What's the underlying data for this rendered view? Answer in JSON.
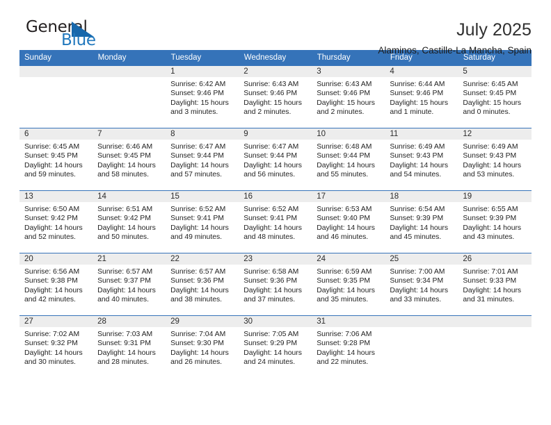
{
  "brand": {
    "name_part1": "General",
    "name_part2": "Blue",
    "logo_icon": "triangle-logo-icon",
    "colors": {
      "accent": "#2178bd",
      "dark": "#231f20"
    }
  },
  "header": {
    "title": "July 2025",
    "subtitle": "Alaminos, Castille-La Mancha, Spain"
  },
  "calendar": {
    "header_bg": "#3573b9",
    "daynum_bg": "#ededed",
    "weekdays": [
      "Sunday",
      "Monday",
      "Tuesday",
      "Wednesday",
      "Thursday",
      "Friday",
      "Saturday"
    ],
    "weeks": [
      [
        {
          "day": "",
          "empty": true
        },
        {
          "day": "",
          "empty": true
        },
        {
          "day": "1",
          "sunrise": "Sunrise: 6:42 AM",
          "sunset": "Sunset: 9:46 PM",
          "daylight": "Daylight: 15 hours and 3 minutes."
        },
        {
          "day": "2",
          "sunrise": "Sunrise: 6:43 AM",
          "sunset": "Sunset: 9:46 PM",
          "daylight": "Daylight: 15 hours and 2 minutes."
        },
        {
          "day": "3",
          "sunrise": "Sunrise: 6:43 AM",
          "sunset": "Sunset: 9:46 PM",
          "daylight": "Daylight: 15 hours and 2 minutes."
        },
        {
          "day": "4",
          "sunrise": "Sunrise: 6:44 AM",
          "sunset": "Sunset: 9:46 PM",
          "daylight": "Daylight: 15 hours and 1 minute."
        },
        {
          "day": "5",
          "sunrise": "Sunrise: 6:45 AM",
          "sunset": "Sunset: 9:45 PM",
          "daylight": "Daylight: 15 hours and 0 minutes."
        }
      ],
      [
        {
          "day": "6",
          "sunrise": "Sunrise: 6:45 AM",
          "sunset": "Sunset: 9:45 PM",
          "daylight": "Daylight: 14 hours and 59 minutes."
        },
        {
          "day": "7",
          "sunrise": "Sunrise: 6:46 AM",
          "sunset": "Sunset: 9:45 PM",
          "daylight": "Daylight: 14 hours and 58 minutes."
        },
        {
          "day": "8",
          "sunrise": "Sunrise: 6:47 AM",
          "sunset": "Sunset: 9:44 PM",
          "daylight": "Daylight: 14 hours and 57 minutes."
        },
        {
          "day": "9",
          "sunrise": "Sunrise: 6:47 AM",
          "sunset": "Sunset: 9:44 PM",
          "daylight": "Daylight: 14 hours and 56 minutes."
        },
        {
          "day": "10",
          "sunrise": "Sunrise: 6:48 AM",
          "sunset": "Sunset: 9:44 PM",
          "daylight": "Daylight: 14 hours and 55 minutes."
        },
        {
          "day": "11",
          "sunrise": "Sunrise: 6:49 AM",
          "sunset": "Sunset: 9:43 PM",
          "daylight": "Daylight: 14 hours and 54 minutes."
        },
        {
          "day": "12",
          "sunrise": "Sunrise: 6:49 AM",
          "sunset": "Sunset: 9:43 PM",
          "daylight": "Daylight: 14 hours and 53 minutes."
        }
      ],
      [
        {
          "day": "13",
          "sunrise": "Sunrise: 6:50 AM",
          "sunset": "Sunset: 9:42 PM",
          "daylight": "Daylight: 14 hours and 52 minutes."
        },
        {
          "day": "14",
          "sunrise": "Sunrise: 6:51 AM",
          "sunset": "Sunset: 9:42 PM",
          "daylight": "Daylight: 14 hours and 50 minutes."
        },
        {
          "day": "15",
          "sunrise": "Sunrise: 6:52 AM",
          "sunset": "Sunset: 9:41 PM",
          "daylight": "Daylight: 14 hours and 49 minutes."
        },
        {
          "day": "16",
          "sunrise": "Sunrise: 6:52 AM",
          "sunset": "Sunset: 9:41 PM",
          "daylight": "Daylight: 14 hours and 48 minutes."
        },
        {
          "day": "17",
          "sunrise": "Sunrise: 6:53 AM",
          "sunset": "Sunset: 9:40 PM",
          "daylight": "Daylight: 14 hours and 46 minutes."
        },
        {
          "day": "18",
          "sunrise": "Sunrise: 6:54 AM",
          "sunset": "Sunset: 9:39 PM",
          "daylight": "Daylight: 14 hours and 45 minutes."
        },
        {
          "day": "19",
          "sunrise": "Sunrise: 6:55 AM",
          "sunset": "Sunset: 9:39 PM",
          "daylight": "Daylight: 14 hours and 43 minutes."
        }
      ],
      [
        {
          "day": "20",
          "sunrise": "Sunrise: 6:56 AM",
          "sunset": "Sunset: 9:38 PM",
          "daylight": "Daylight: 14 hours and 42 minutes."
        },
        {
          "day": "21",
          "sunrise": "Sunrise: 6:57 AM",
          "sunset": "Sunset: 9:37 PM",
          "daylight": "Daylight: 14 hours and 40 minutes."
        },
        {
          "day": "22",
          "sunrise": "Sunrise: 6:57 AM",
          "sunset": "Sunset: 9:36 PM",
          "daylight": "Daylight: 14 hours and 38 minutes."
        },
        {
          "day": "23",
          "sunrise": "Sunrise: 6:58 AM",
          "sunset": "Sunset: 9:36 PM",
          "daylight": "Daylight: 14 hours and 37 minutes."
        },
        {
          "day": "24",
          "sunrise": "Sunrise: 6:59 AM",
          "sunset": "Sunset: 9:35 PM",
          "daylight": "Daylight: 14 hours and 35 minutes."
        },
        {
          "day": "25",
          "sunrise": "Sunrise: 7:00 AM",
          "sunset": "Sunset: 9:34 PM",
          "daylight": "Daylight: 14 hours and 33 minutes."
        },
        {
          "day": "26",
          "sunrise": "Sunrise: 7:01 AM",
          "sunset": "Sunset: 9:33 PM",
          "daylight": "Daylight: 14 hours and 31 minutes."
        }
      ],
      [
        {
          "day": "27",
          "sunrise": "Sunrise: 7:02 AM",
          "sunset": "Sunset: 9:32 PM",
          "daylight": "Daylight: 14 hours and 30 minutes."
        },
        {
          "day": "28",
          "sunrise": "Sunrise: 7:03 AM",
          "sunset": "Sunset: 9:31 PM",
          "daylight": "Daylight: 14 hours and 28 minutes."
        },
        {
          "day": "29",
          "sunrise": "Sunrise: 7:04 AM",
          "sunset": "Sunset: 9:30 PM",
          "daylight": "Daylight: 14 hours and 26 minutes."
        },
        {
          "day": "30",
          "sunrise": "Sunrise: 7:05 AM",
          "sunset": "Sunset: 9:29 PM",
          "daylight": "Daylight: 14 hours and 24 minutes."
        },
        {
          "day": "31",
          "sunrise": "Sunrise: 7:06 AM",
          "sunset": "Sunset: 9:28 PM",
          "daylight": "Daylight: 14 hours and 22 minutes."
        },
        {
          "day": "",
          "empty": true
        },
        {
          "day": "",
          "empty": true
        }
      ]
    ]
  }
}
